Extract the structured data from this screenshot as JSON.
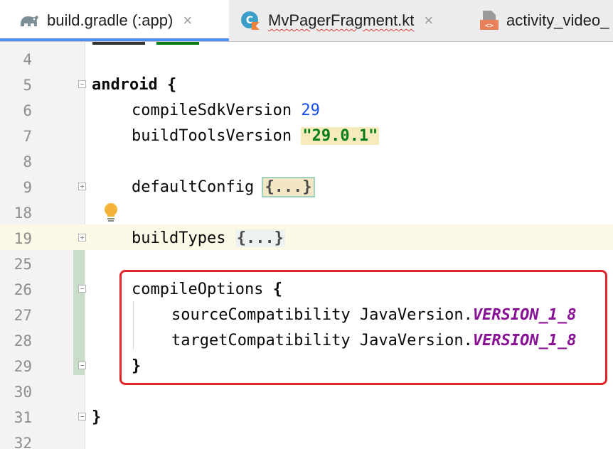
{
  "tabs": [
    {
      "label": "build.gradle (:app)",
      "icon": "gradle-elephant-icon",
      "active": true,
      "close": "×"
    },
    {
      "label": "MvPagerFragment.kt",
      "icon": "kotlin-class-icon",
      "active": false,
      "close": "×"
    },
    {
      "label": "activity_video_",
      "icon": "layout-xml-icon",
      "active": false
    }
  ],
  "editor": {
    "lines": [
      {
        "number": "4"
      },
      {
        "number": "5",
        "code": "android {"
      },
      {
        "number": "6",
        "prop": "compileSdkVersion ",
        "value": "29"
      },
      {
        "number": "7",
        "prop": "buildToolsVersion ",
        "value": "\"29.0.1\""
      },
      {
        "number": "8"
      },
      {
        "number": "9",
        "prop": "defaultConfig ",
        "folded": "{...}"
      },
      {
        "number": "18"
      },
      {
        "number": "19",
        "prop": "buildTypes ",
        "folded": "{...}"
      },
      {
        "number": "25"
      },
      {
        "number": "26",
        "prop": "compileOptions ",
        "brace": "{"
      },
      {
        "number": "27",
        "prop": "sourceCompatibility JavaVersion.",
        "konst": "VERSION_1_8"
      },
      {
        "number": "28",
        "prop": "targetCompatibility JavaVersion.",
        "konst": "VERSION_1_8"
      },
      {
        "number": "29",
        "brace": "}"
      },
      {
        "number": "30"
      },
      {
        "number": "31",
        "brace": "}"
      },
      {
        "number": "32"
      }
    ]
  },
  "colors": {
    "highlight_box": "#e0262b",
    "string": "#067d17",
    "number": "#1750eb",
    "constant": "#871094",
    "active_tab_underline": "#4a8ff1"
  }
}
